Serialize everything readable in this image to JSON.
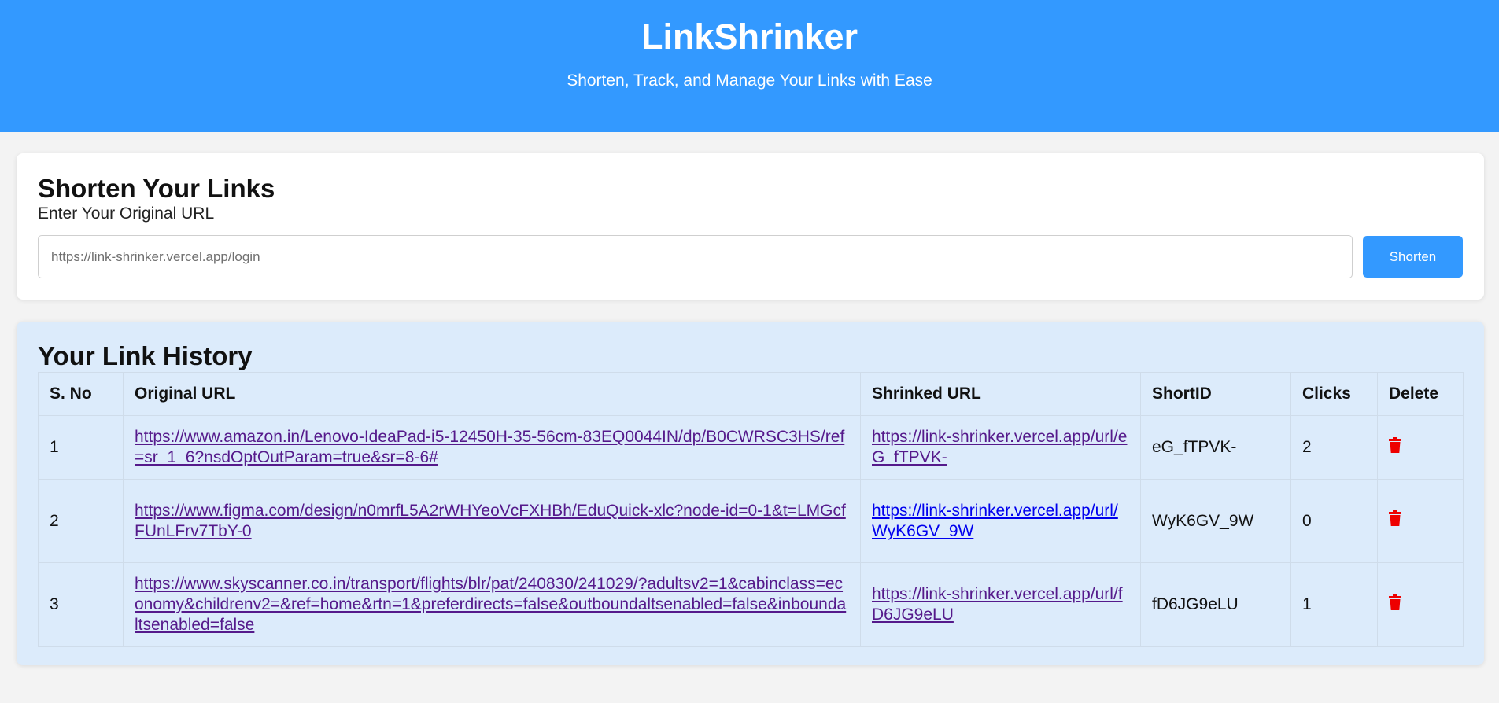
{
  "header": {
    "title": "LinkShrinker",
    "tagline": "Shorten, Track, and Manage Your Links with Ease",
    "background_color": "#3399ff"
  },
  "shorten": {
    "heading": "Shorten Your Links",
    "label": "Enter Your Original URL",
    "input_placeholder": "https://link-shrinker.vercel.app/login",
    "button_label": "Shorten"
  },
  "history": {
    "heading": "Your Link History",
    "columns": [
      "S. No",
      "Original URL",
      "Shrinked URL",
      "ShortID",
      "Clicks",
      "Delete"
    ],
    "rows": [
      {
        "sno": "1",
        "original_url": "https://www.amazon.in/Lenovo-IdeaPad-i5-12450H-35-56cm-83EQ0044IN/dp/B0CWRSC3HS/ref=sr_1_6?nsdOptOutParam=true&sr=8-6#",
        "shrinked_url": "https://link-shrinker.vercel.app/url/eG_fTPVK-",
        "short_id": "eG_fTPVK-",
        "clicks": "2",
        "delete_icon": "trash-icon"
      },
      {
        "sno": "2",
        "original_url": "https://www.figma.com/design/n0mrfL5A2rWHYeoVcFXHBh/EduQuick-xlc?node-id=0-1&t=LMGcfFUnLFrv7TbY-0",
        "shrinked_url": "https://link-shrinker.vercel.app/url/WyK6GV_9W",
        "short_id": "WyK6GV_9W",
        "clicks": "0",
        "delete_icon": "trash-icon"
      },
      {
        "sno": "3",
        "original_url": "https://www.skyscanner.co.in/transport/flights/blr/pat/240830/241029/?adultsv2=1&cabinclass=economy&childrenv2=&ref=home&rtn=1&preferdirects=false&outboundaltsenabled=false&inboundaltsenabled=false",
        "shrinked_url": "https://link-shrinker.vercel.app/url/fD6JG9eLU",
        "short_id": "fD6JG9eLU",
        "clicks": "1",
        "delete_icon": "trash-icon"
      }
    ],
    "delete_color": "#ee0000"
  }
}
